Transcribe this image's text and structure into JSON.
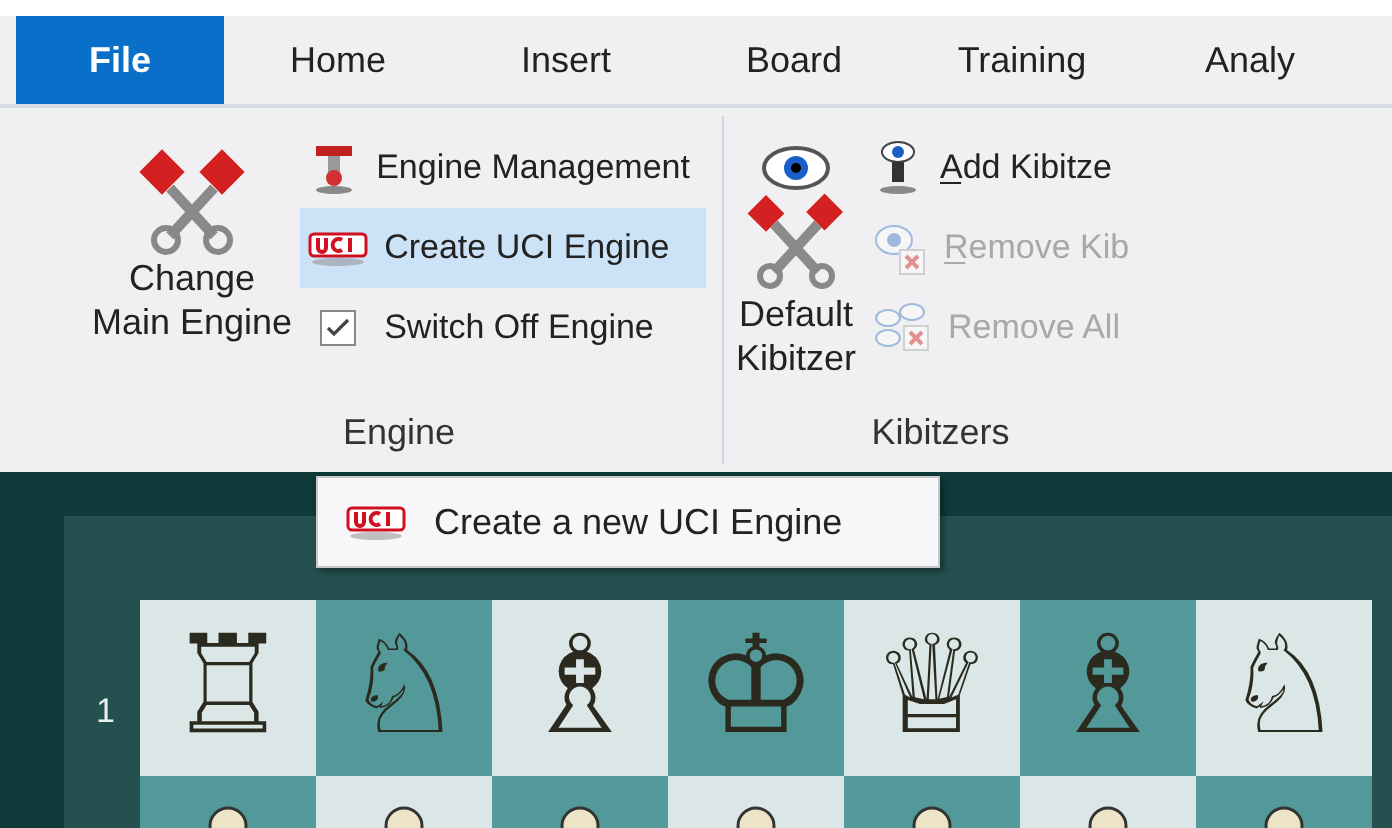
{
  "tabs": [
    {
      "label": "File",
      "selected": true
    },
    {
      "label": "Home",
      "selected": false
    },
    {
      "label": "Insert",
      "selected": false
    },
    {
      "label": "Board",
      "selected": false
    },
    {
      "label": "Training",
      "selected": false
    },
    {
      "label": "Analy",
      "selected": false
    }
  ],
  "groups": [
    {
      "label": "Engine",
      "large": {
        "label": "Change Main Engine",
        "kind": "engine"
      },
      "items": [
        {
          "kind": "management",
          "label": "Engine Management",
          "disabled": false,
          "highlighted": false,
          "mnemonic": false
        },
        {
          "kind": "uci",
          "label": "Create UCI Engine",
          "disabled": false,
          "highlighted": true,
          "mnemonic": false
        },
        {
          "kind": "check",
          "label": "Switch Off Engine",
          "checked": true,
          "disabled": false,
          "highlighted": false,
          "mnemonic": false
        }
      ]
    },
    {
      "label": "Kibitzers",
      "large": {
        "label": "Default Kibitzer",
        "kind": "kibitzer"
      },
      "items": [
        {
          "kind": "add",
          "label": "Add Kibitze",
          "disabled": false,
          "highlighted": false,
          "mnemonic": true
        },
        {
          "kind": "remove",
          "label": "Remove Kib",
          "disabled": true,
          "highlighted": false,
          "mnemonic": true
        },
        {
          "kind": "remove_all",
          "label": "Remove All",
          "disabled": true,
          "highlighted": false,
          "mnemonic": false
        }
      ]
    }
  ],
  "tooltip": {
    "text": "Create a new UCI Engine"
  },
  "board": {
    "rank": "1",
    "pieces": [
      "♖",
      "♘",
      "♗",
      "♔",
      "♕",
      "♗",
      "♘"
    ]
  }
}
